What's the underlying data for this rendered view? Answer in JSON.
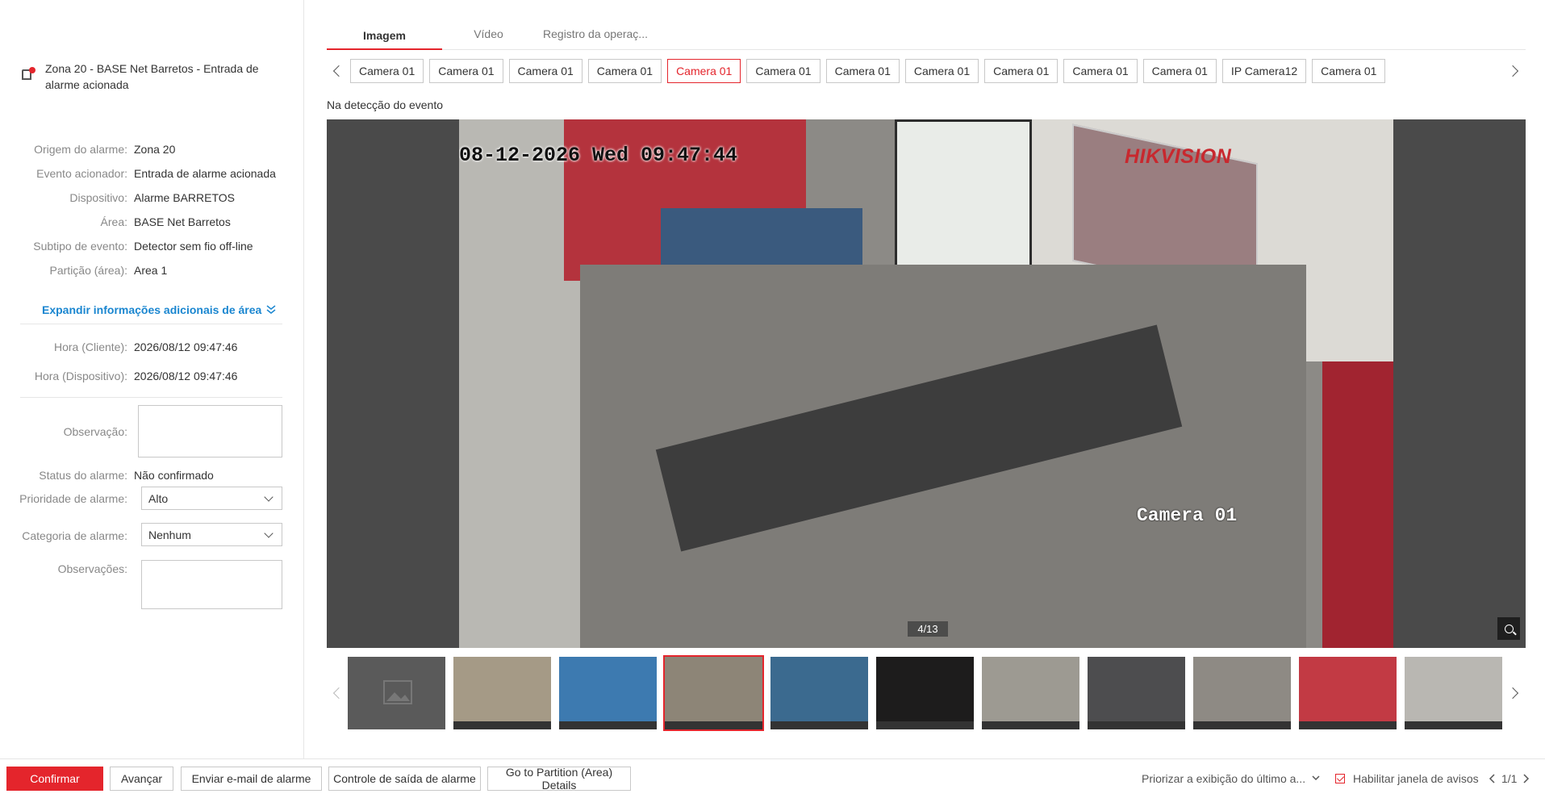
{
  "alarm": {
    "title": "Zona 20 - BASE Net Barretos - Entrada de alarme acionada"
  },
  "details": [
    {
      "label": "Origem do alarme:",
      "value": "Zona 20"
    },
    {
      "label": "Evento acionador:",
      "value": "Entrada de alarme acionada"
    },
    {
      "label": "Dispositivo:",
      "value": "Alarme BARRETOS"
    },
    {
      "label": "Área:",
      "value": "BASE Net Barretos"
    },
    {
      "label": "Subtipo de evento:",
      "value": "Detector sem fio off-line"
    },
    {
      "label": "Partição (área):",
      "value": "Area 1"
    }
  ],
  "expand_label": "Expandir informações adicionais de área",
  "times": [
    {
      "label": "Hora (Cliente):",
      "value": "2026/08/12 09:47:46"
    },
    {
      "label": "Hora (Dispositivo):",
      "value": "2026/08/12 09:47:46"
    }
  ],
  "form": {
    "observation_label": "Observação:",
    "status_label": "Status do alarme:",
    "status_value": "Não confirmado",
    "priority_label": "Prioridade de alarme:",
    "priority_value": "Alto",
    "category_label": "Categoria de alarme:",
    "category_value": "Nenhum",
    "notes_label": "Observações:"
  },
  "tabs": [
    "Imagem",
    "Vídeo",
    "Registro da operaç..."
  ],
  "cameras": [
    "Camera 01",
    "Camera 01",
    "Camera 01",
    "Camera 01",
    "Camera 01",
    "Camera 01",
    "Camera 01",
    "Camera 01",
    "Camera 01",
    "Camera 01",
    "Camera 01",
    "IP Camera12",
    "Camera 01"
  ],
  "selected_camera_index": 4,
  "caption": "Na detecção do evento",
  "viewer": {
    "timestamp": "08-12-2026 Wed 09:47:44",
    "brand": "HIKVISION",
    "camera_label": "Camera 01",
    "counter": "4/13"
  },
  "thumbnails": {
    "count": 11,
    "selected_index": 3,
    "colors": [
      "#5a5a5a",
      "#a59a86",
      "#3d7ab0",
      "#8d8577",
      "#3b6a8f",
      "#1d1c1c",
      "#9d9a92",
      "#4d4d4f",
      "#8e8a84",
      "#c23a44",
      "#b9b7b2"
    ]
  },
  "footer": {
    "confirm": "Confirmar",
    "next": "Avançar",
    "email": "Enviar e-mail de alarme",
    "output": "Controle de saída de alarme",
    "partition": "Go to Partition (Area) Details",
    "prioritize": "Priorizar a exibição do último a...",
    "enable_popup": "Habilitar janela de avisos",
    "pages": "1/1"
  },
  "colors": {
    "accent": "#e4252c",
    "link": "#1a86d0"
  }
}
